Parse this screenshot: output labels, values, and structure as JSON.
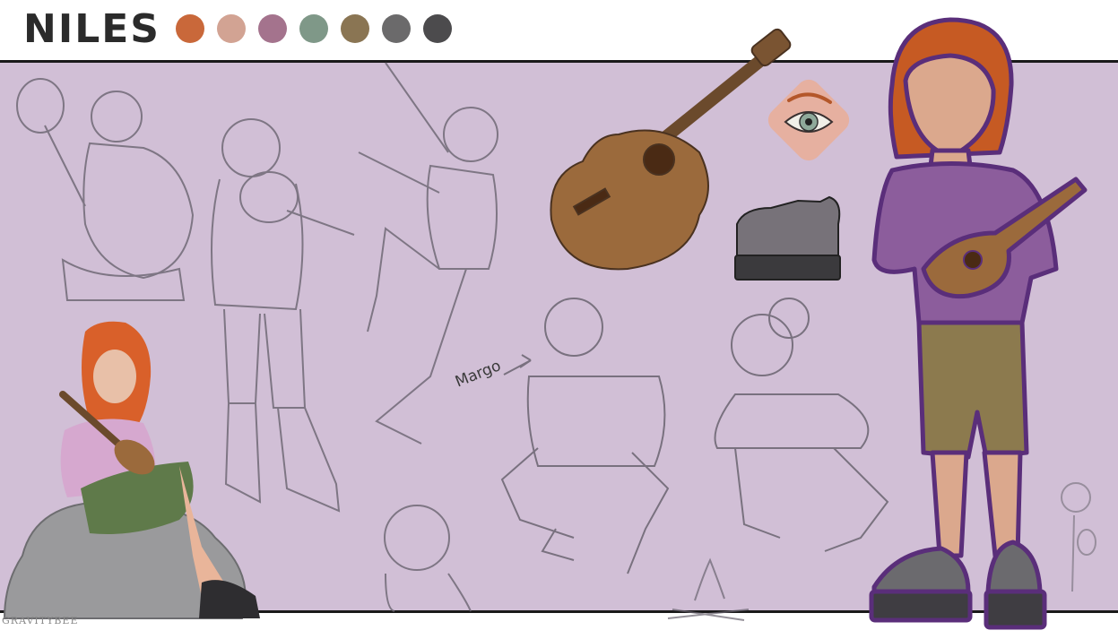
{
  "header": {
    "title": "NILES",
    "palette": [
      "#c9683a",
      "#d2a393",
      "#a4738d",
      "#7f9888",
      "#8a7553",
      "#6b6a6b",
      "#4c4b4d"
    ]
  },
  "annotations": {
    "margo_label": "Margo"
  },
  "signature": "GRAVITYBEE",
  "colors": {
    "panel": "#d1bfd6",
    "hair": "#c65a23",
    "shirt": "#8c5d9c",
    "shorts": "#8c7a4e",
    "outline": "#5a2e7a",
    "ukulele": "#9b6a3c"
  }
}
